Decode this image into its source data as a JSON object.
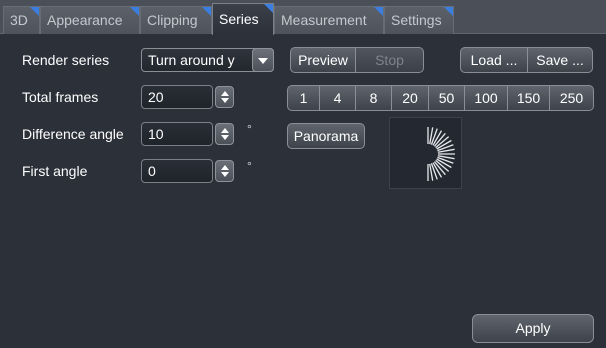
{
  "tabs": [
    {
      "label": "3D",
      "active": false
    },
    {
      "label": "Appearance",
      "active": false
    },
    {
      "label": "Clipping",
      "active": false
    },
    {
      "label": "Series",
      "active": true
    },
    {
      "label": "Measurement",
      "active": false
    },
    {
      "label": "Settings",
      "active": false
    }
  ],
  "form": {
    "render_series_label": "Render series",
    "render_series_value": "Turn around y",
    "total_frames_label": "Total frames",
    "total_frames_value": "20",
    "difference_angle_label": "Difference angle",
    "difference_angle_value": "10",
    "difference_angle_unit": "°",
    "first_angle_label": "First angle",
    "first_angle_value": "0",
    "first_angle_unit": "°"
  },
  "buttons": {
    "preview": "Preview",
    "stop": "Stop",
    "load": "Load ...",
    "save": "Save ...",
    "panorama": "Panorama",
    "apply": "Apply"
  },
  "frame_presets": [
    "1",
    "4",
    "8",
    "20",
    "50",
    "100",
    "150",
    "250"
  ],
  "colors": {
    "background": "#2c3039",
    "tab_accent": "#3a7ee0"
  }
}
